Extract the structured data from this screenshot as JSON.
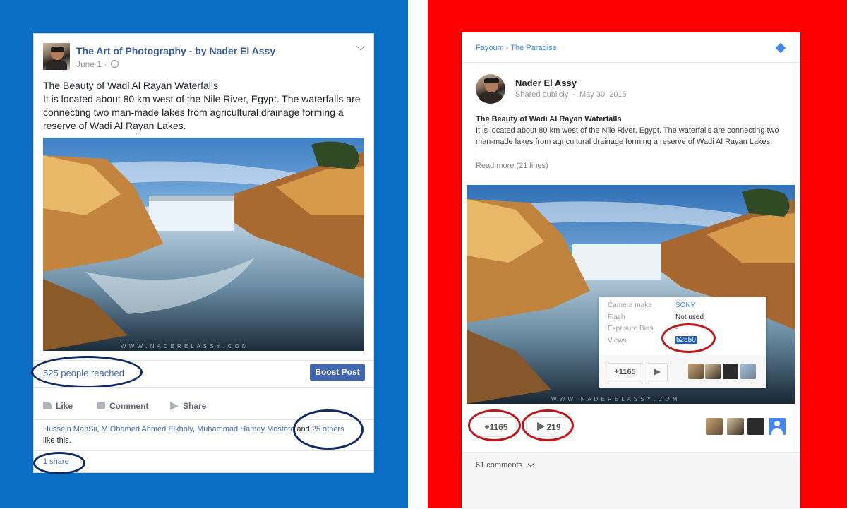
{
  "facebook": {
    "page_name": "The Art of Photography - by Nader El Assy",
    "date": "June 1 ·",
    "post_title": "The Beauty of Wadi Al Rayan Waterfalls",
    "post_body": "It is located about 80 km west of the Nile River, Egypt. The waterfalls are connecting two man-made lakes from agricultural drainage forming a reserve of Wadi Al Rayan Lakes.",
    "watermark": "W W W . N A D E R E L A S S Y . C O M",
    "reach": "525 people reached",
    "boost_label": "Boost Post",
    "actions": [
      "Like",
      "Comment",
      "Share"
    ],
    "likers": [
      "Hussein ManSii",
      "M Ohamed Ahmed Elkholy",
      "Muhammad Hamdy Mostafa"
    ],
    "likers_sep": ", ",
    "likers_and": " and ",
    "likers_others": "25 others",
    "likers_suffix": "like this.",
    "shares": "1 share",
    "colors": {
      "panel": "#0a6ec4",
      "link": "#4267b2",
      "boost": "#4267b2"
    }
  },
  "gplus": {
    "community": "Fayoum - The Paradise",
    "author": "Nader El Assy",
    "visibility": "Shared publicly",
    "separator": "-",
    "date": "May 30, 2015",
    "post_title": "The Beauty of Wadi Al Rayan Waterfalls",
    "post_body": "It is located about 80 km west of the Nile River, Egypt. The waterfalls are connecting two man-made lakes from agricultural drainage forming a reserve of Wadi Al Rayan Lakes.",
    "read_more": "Read more (21 lines)",
    "watermark": "W W W . N A D E R E L A S S Y . C O M",
    "exif": [
      {
        "label": "Camera make",
        "value": "SONY"
      },
      {
        "label": "Flash",
        "value": "Not used"
      },
      {
        "label": "Exposure Bias",
        "value": "-"
      },
      {
        "label": "Views",
        "value": "52550"
      }
    ],
    "plus_count": "+1165",
    "share_count": "219",
    "comments": "61 comments",
    "colors": {
      "panel": "#ff0000",
      "ring": "#c0161b",
      "link": "#4285f4"
    }
  }
}
